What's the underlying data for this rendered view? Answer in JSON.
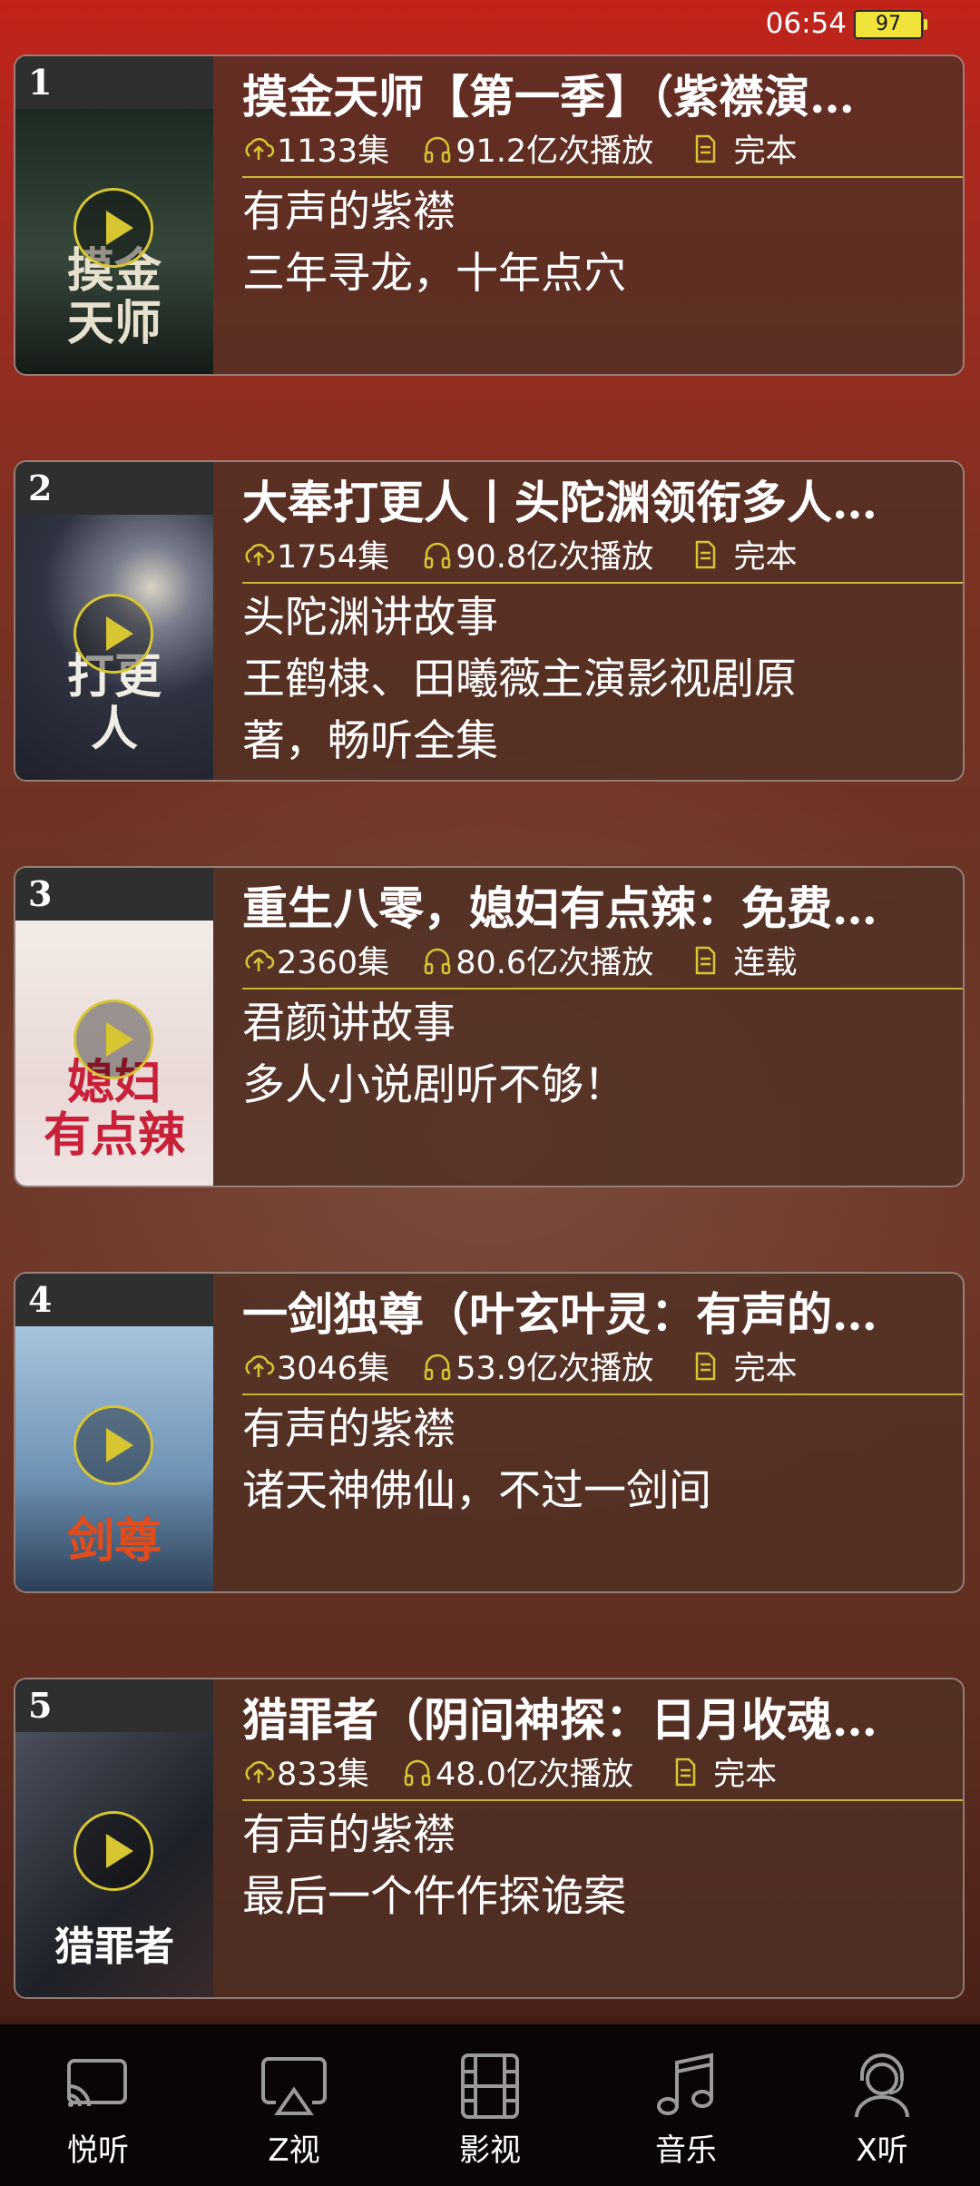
{
  "status": {
    "time": "06:54",
    "battery": "97"
  },
  "items": [
    {
      "rank": "1",
      "title": "摸金天师【第一季】（紫襟演…",
      "episodes": "1133集",
      "plays": "91.2亿次播放",
      "state": "完本",
      "lines": [
        "有声的紫襟",
        "三年寻龙，十年点穴"
      ]
    },
    {
      "rank": "2",
      "title": "大奉打更人丨头陀渊领衔多人…",
      "episodes": "1754集",
      "plays": "90.8亿次播放",
      "state": "完本",
      "lines": [
        "头陀渊讲故事",
        "王鹤棣、田曦薇主演影视剧原",
        "著，畅听全集"
      ]
    },
    {
      "rank": "3",
      "title": "重生八零，媳妇有点辣：免费…",
      "episodes": "2360集",
      "plays": "80.6亿次播放",
      "state": "连载",
      "lines": [
        "君颜讲故事",
        "多人小说剧听不够！"
      ]
    },
    {
      "rank": "4",
      "title": "一剑独尊（叶玄叶灵：有声的…",
      "episodes": "3046集",
      "plays": "53.9亿次播放",
      "state": "完本",
      "lines": [
        "有声的紫襟",
        "诸天神佛仙，不过一剑间"
      ]
    },
    {
      "rank": "5",
      "title": "猎罪者（阴间神探：日月收魂…",
      "episodes": "833集",
      "plays": "48.0亿次播放",
      "state": "完本",
      "lines": [
        "有声的紫襟",
        "最后一个仵作探诡案"
      ]
    }
  ],
  "covers": [
    {
      "text": "摸金\n天师",
      "bg": "#2d3a2a",
      "fg": "#e8e0cf"
    },
    {
      "text": "打更\n人",
      "bg": "#3a3c4a",
      "fg": "#f0ede5"
    },
    {
      "text": "媳妇\n有点辣",
      "bg": "#efe7e4",
      "fg": "#c9203a"
    },
    {
      "text": "剑尊",
      "bg": "#7ea4c6",
      "fg": "#e24b1a"
    },
    {
      "text": "猎罪者",
      "bg": "#2a2c33",
      "fg": "#ffffff"
    }
  ],
  "nav": [
    {
      "label": "悦听",
      "icon": "cast-icon"
    },
    {
      "label": "Z视",
      "icon": "airplay-icon"
    },
    {
      "label": "影视",
      "icon": "film-icon"
    },
    {
      "label": "音乐",
      "icon": "music-icon"
    },
    {
      "label": "X听",
      "icon": "headset-user-icon"
    }
  ],
  "colors": {
    "accent": "#d7c531",
    "battery": "#f2e33b"
  }
}
